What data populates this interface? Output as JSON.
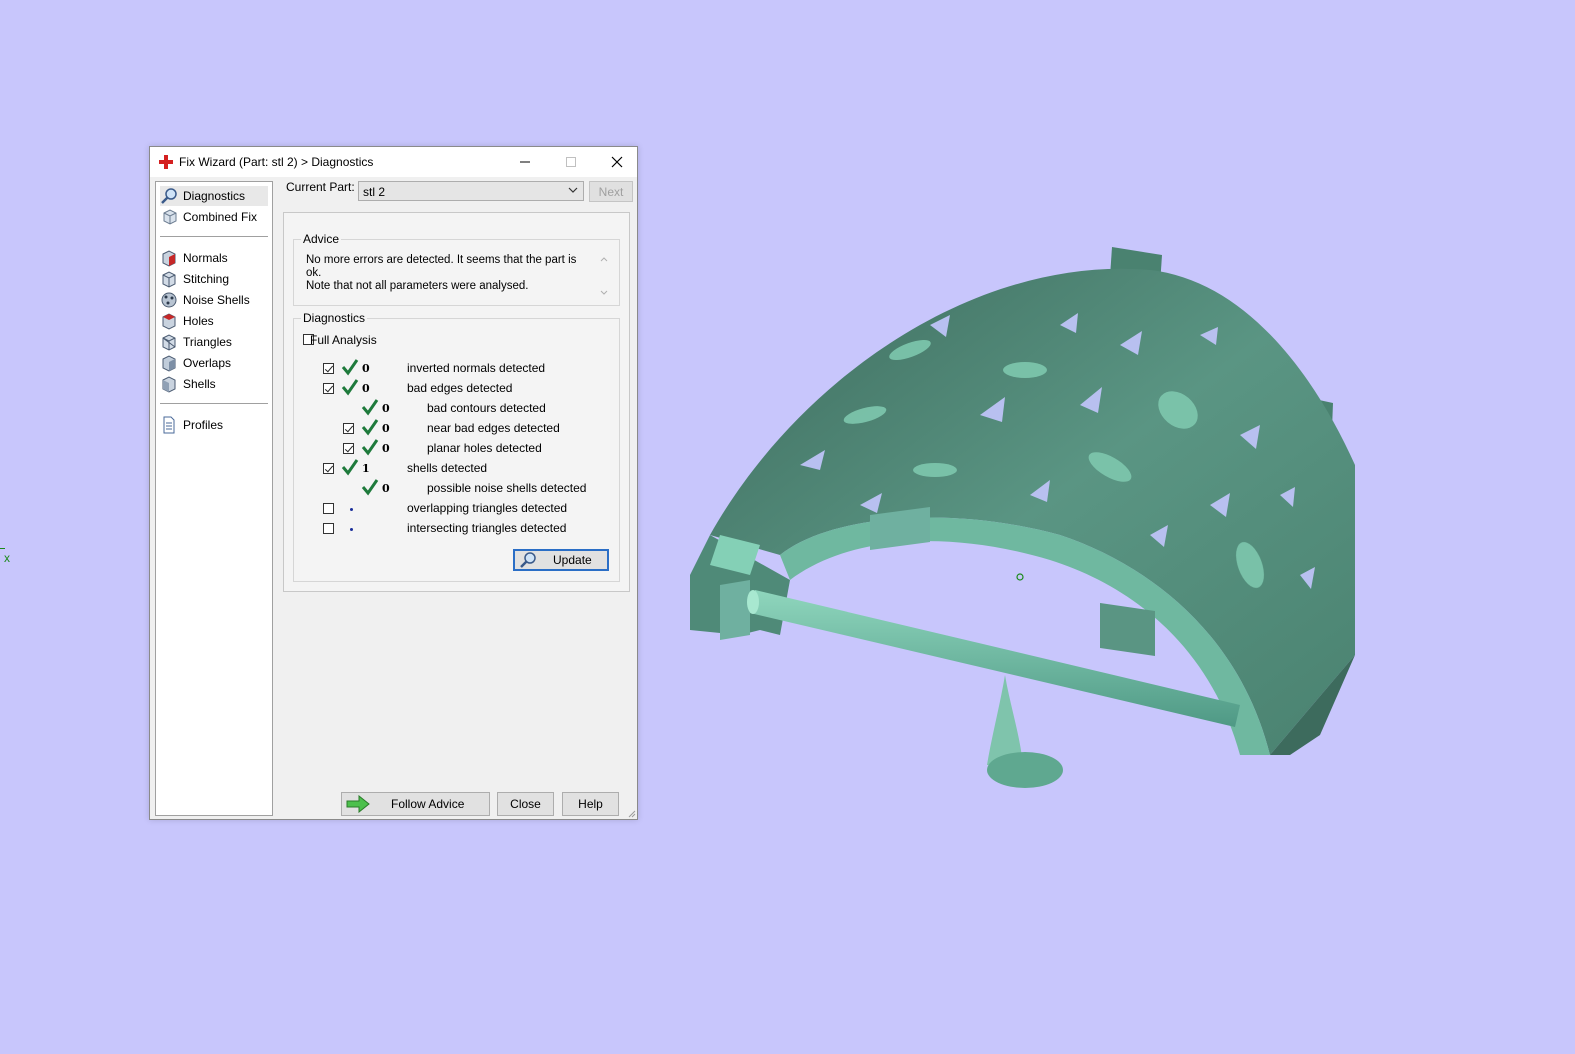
{
  "axis_indicator": {
    "label": "x",
    "color": "#1a8a1a"
  },
  "background_color": "#c8c6fc",
  "window": {
    "title": "Fix Wizard (Part: stl 2) > Diagnostics",
    "buttons": {
      "minimize": "minimize",
      "maximize": "maximize",
      "close": "close"
    }
  },
  "nav": {
    "items": [
      {
        "label": "Diagnostics",
        "icon": "magnifier-icon",
        "selected": true
      },
      {
        "label": "Combined Fix",
        "icon": "cube-icon"
      },
      {
        "label": "Normals",
        "icon": "normals-cube-icon"
      },
      {
        "label": "Stitching",
        "icon": "stitching-cube-icon"
      },
      {
        "label": "Noise Shells",
        "icon": "noise-shells-icon"
      },
      {
        "label": "Holes",
        "icon": "holes-cube-icon"
      },
      {
        "label": "Triangles",
        "icon": "triangles-cube-icon"
      },
      {
        "label": "Overlaps",
        "icon": "overlaps-cube-icon"
      },
      {
        "label": "Shells",
        "icon": "shells-cube-icon"
      },
      {
        "label": "Profiles",
        "icon": "document-icon"
      }
    ]
  },
  "current_part": {
    "label": "Current Part:",
    "value": "stl 2"
  },
  "next_label": "Next",
  "advice": {
    "title": "Advice",
    "line1": "No more errors are detected. It seems that the part is ok.",
    "line2": "Note that not all parameters were analysed."
  },
  "diagnostics": {
    "title": "Diagnostics",
    "full_analysis": {
      "label": "Full Analysis",
      "checked": false
    },
    "rows": [
      {
        "checked": true,
        "ok": true,
        "count": "0",
        "label": "inverted normals detected"
      },
      {
        "checked": true,
        "ok": true,
        "count": "0",
        "label": "bad edges detected"
      },
      {
        "checkbox": false,
        "ok": true,
        "count": "0",
        "label": "bad contours detected"
      },
      {
        "checked": true,
        "ok": true,
        "count": "0",
        "label": "near bad edges detected"
      },
      {
        "checked": true,
        "ok": true,
        "count": "0",
        "label": "planar holes detected"
      },
      {
        "checked": true,
        "ok": true,
        "count": "1",
        "label": "shells detected"
      },
      {
        "checkbox": false,
        "ok": true,
        "count": "0",
        "label": "possible noise shells detected"
      },
      {
        "checked": false,
        "ok": false,
        "label": "overlapping triangles detected"
      },
      {
        "checked": false,
        "ok": false,
        "label": "intersecting triangles detected"
      }
    ],
    "update_label": "Update"
  },
  "footer": {
    "follow_advice": "Follow Advice",
    "close": "Close",
    "help": "Help"
  },
  "colors": {
    "check_green": "#1e7a3c",
    "model_teal": "#5fa890",
    "accent_blue": "#2a6ec6"
  }
}
